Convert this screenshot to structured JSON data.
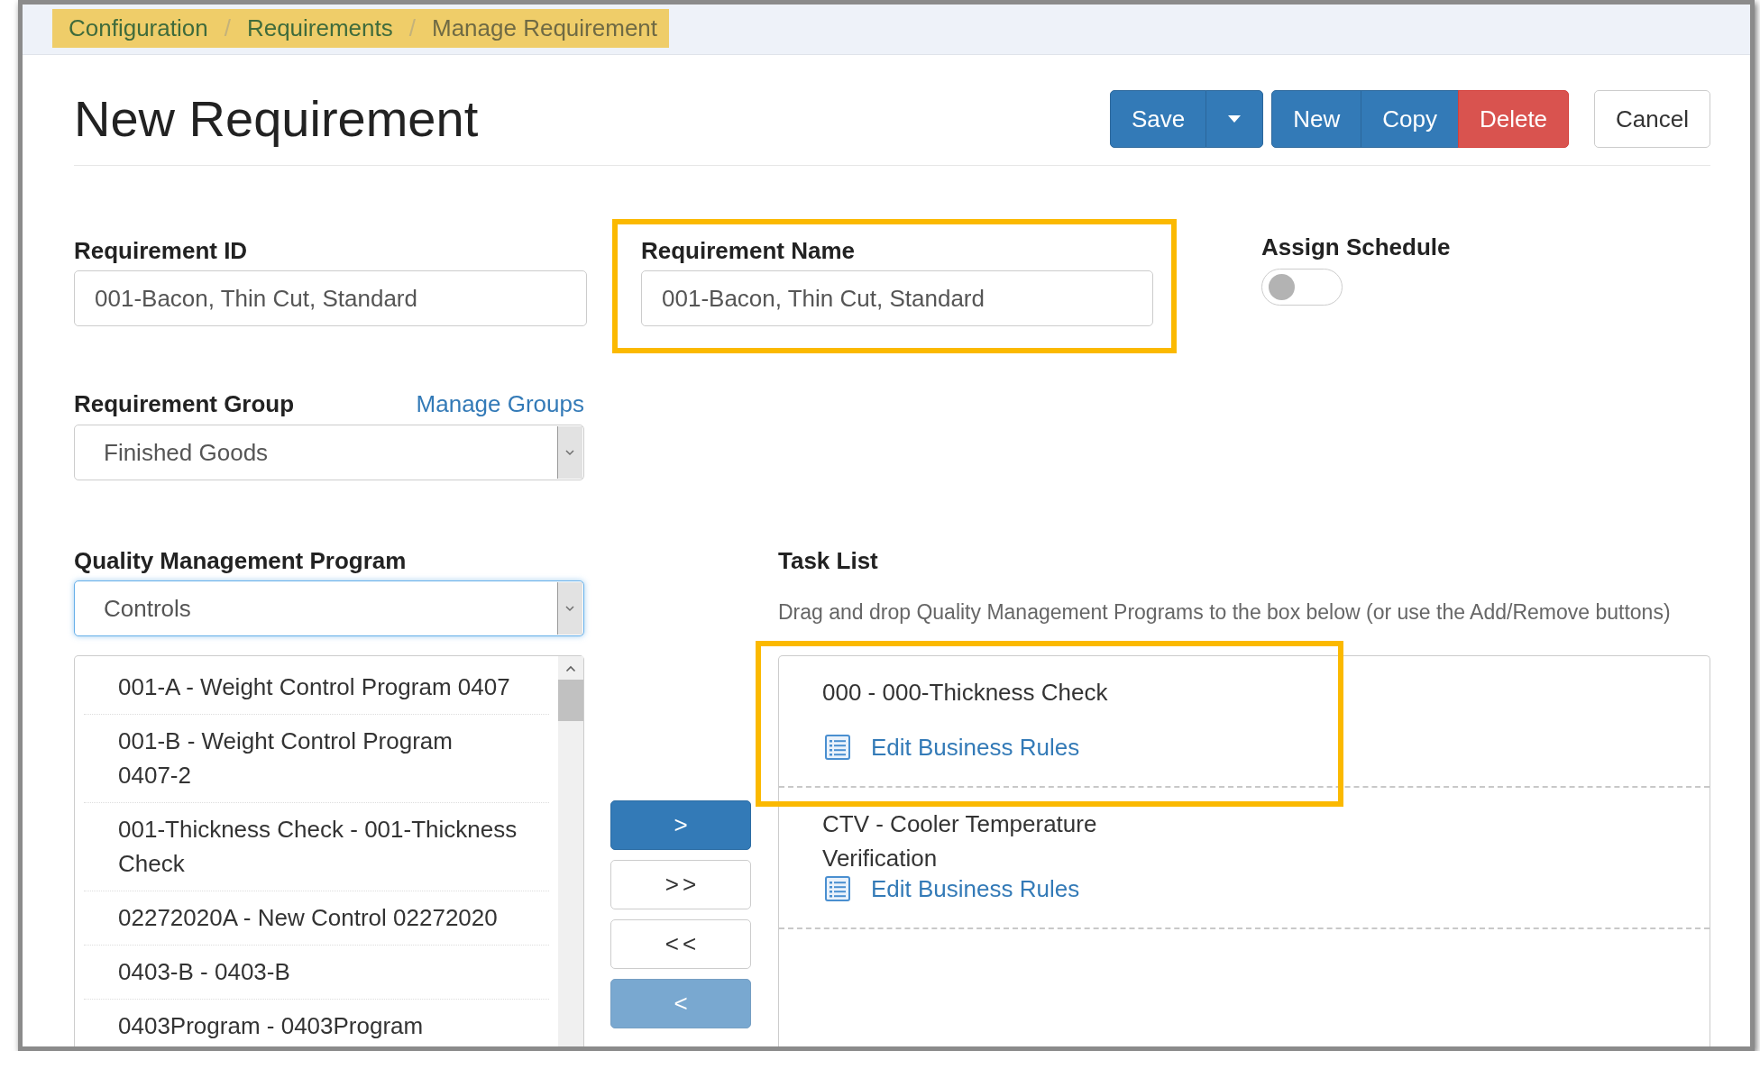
{
  "breadcrumb": {
    "items": [
      {
        "label": "Configuration",
        "current": false
      },
      {
        "label": "Requirements",
        "current": false
      },
      {
        "label": "Manage Requirement",
        "current": true
      }
    ],
    "separators": [
      "/",
      "/"
    ]
  },
  "title": "New Requirement",
  "toolbar": [
    [
      {
        "label": "Save",
        "kind": "primary"
      },
      {
        "kind": "caret"
      }
    ],
    [
      {
        "label": "New",
        "kind": "primary"
      },
      {
        "label": "Copy",
        "kind": "primary"
      },
      {
        "label": "Delete",
        "kind": "danger"
      }
    ],
    [
      {
        "label": "Cancel",
        "kind": "default"
      }
    ]
  ],
  "requirement_id": {
    "label": "Requirement ID",
    "value": "001-Bacon, Thin Cut, Standard"
  },
  "requirement_name": {
    "label": "Requirement Name",
    "value": "001-Bacon, Thin Cut, Standard",
    "highlighted": true
  },
  "assign_schedule": {
    "label": "Assign Schedule",
    "on": false
  },
  "requirement_group": {
    "label": "Requirement Group",
    "link": "Manage Groups",
    "value": "Finished Goods"
  },
  "quality_program": {
    "label": "Quality Management Program",
    "value": "Controls",
    "focused": true,
    "items": [
      {
        "label": "001-A - Weight Control Program 0407",
        "selected": false
      },
      {
        "label": "001-B - Weight Control Program 0407-2",
        "selected": false
      },
      {
        "label": "001-Thickness Check - 001-Thickness Check",
        "selected": false
      },
      {
        "label": "02272020A - New Control 02272020",
        "selected": false
      },
      {
        "label": "0403-B - 0403-B",
        "selected": false
      },
      {
        "label": "0403Program - 0403Program",
        "selected": false
      }
    ]
  },
  "transfer_buttons": [
    {
      "label": ">",
      "kind": "primary",
      "disabled": false
    },
    {
      "label": ">>",
      "kind": "default",
      "disabled": false
    },
    {
      "label": "<<",
      "kind": "default",
      "disabled": false
    },
    {
      "label": "<",
      "kind": "primary",
      "disabled": true
    }
  ],
  "task_list": {
    "label": "Task List",
    "hint": "Drag and drop Quality Management Programs to the box below (or use the Add/Remove buttons)",
    "items": [
      {
        "title": "000 - 000-Thickness Check",
        "link": "Edit Business Rules",
        "highlighted": true
      },
      {
        "title": "CTV - Cooler Temperature Verification",
        "link": "Edit Business Rules",
        "highlighted": false
      }
    ]
  }
}
